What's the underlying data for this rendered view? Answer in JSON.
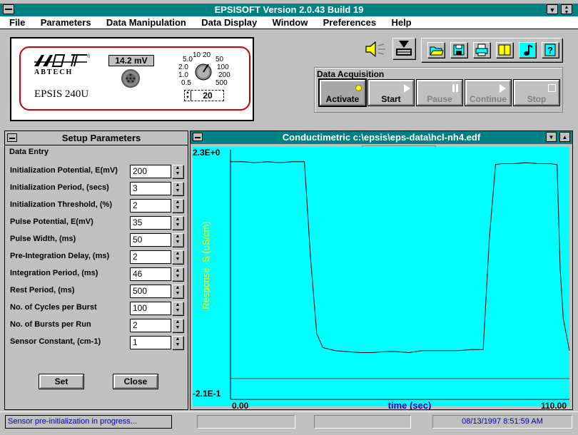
{
  "app": {
    "title": "EPSISOFT Version 2.0.43  Build 19"
  },
  "menu": [
    "File",
    "Parameters",
    "Data Manipulation",
    "Data Display",
    "Window",
    "Preferences",
    "Help"
  ],
  "instrument": {
    "brand": "ABTECH",
    "model": "EPSIS 240U",
    "mv_readout": "14.2 mV",
    "dial_ticks": [
      "5.0",
      "10",
      "20",
      "50",
      "2.0",
      "100",
      "1.0",
      "200",
      "0.5",
      "500"
    ],
    "range_value": "20"
  },
  "toolbar_icons": [
    "open-folder-icon",
    "save-disk-icon",
    "print-icon",
    "book-icon",
    "music-note-icon",
    "help-question-icon"
  ],
  "data_acquisition": {
    "title": "Data Acquisition",
    "buttons": [
      {
        "label": "Activate",
        "enabled": true
      },
      {
        "label": "Start",
        "enabled": true
      },
      {
        "label": "Pause",
        "enabled": false
      },
      {
        "label": "Continue",
        "enabled": false
      },
      {
        "label": "Stop",
        "enabled": false
      }
    ]
  },
  "setup": {
    "title": "Setup Parameters",
    "section": "Data Entry",
    "fields": [
      {
        "label": "Initialization Potential, E(mV)",
        "value": "200"
      },
      {
        "label": "Initialization Period, (secs)",
        "value": "3"
      },
      {
        "label": "Initialization Threshold, (%)",
        "value": "2"
      },
      {
        "label": "Pulse Potential, E(mV)",
        "value": "35"
      },
      {
        "label": "Pulse Width, (ms)",
        "value": "50"
      },
      {
        "label": "Pre-Integration Delay, (ms)",
        "value": "2"
      },
      {
        "label": "Integration Period, (ms)",
        "value": "46"
      },
      {
        "label": "Rest Period, (ms)",
        "value": "500"
      },
      {
        "label": "No. of Cycles per Burst",
        "value": "100"
      },
      {
        "label": "No. of Bursts per Run",
        "value": "2"
      },
      {
        "label": "Sensor Constant, (cm-1)",
        "value": "1"
      }
    ],
    "set_label": "Set",
    "close_label": "Close"
  },
  "plot": {
    "title": "Conductimetric c:\\epsis\\eps-data\\hcl-nh4.edf",
    "colors": {
      "background": "#00ffff",
      "trace": "#000000",
      "label": "#ffff00"
    }
  },
  "chart_data": {
    "type": "line",
    "xlabel": "time (sec)",
    "ylabel": "Response, S (uS/cm)",
    "xlim": [
      0,
      110
    ],
    "ylim": [
      -0.21,
      2.3
    ],
    "y_top_label": "2.3E+0",
    "y_bottom_label": "-2.1E-1",
    "x_left_label": "0.00",
    "x_right_label": "110.00",
    "baseline_y": 0,
    "series": [
      {
        "x": [
          0,
          4,
          8,
          12,
          16,
          20,
          24,
          26,
          28,
          30,
          34,
          38,
          42,
          46,
          50,
          54,
          58,
          62,
          66,
          70,
          74,
          78,
          82,
          84,
          86,
          88,
          92,
          96,
          100,
          104,
          106,
          107,
          108,
          110
        ],
        "y": [
          2.18,
          2.18,
          2.17,
          2.18,
          2.17,
          2.18,
          2.18,
          1.2,
          0.45,
          0.31,
          0.28,
          0.27,
          0.26,
          0.26,
          0.27,
          0.27,
          0.26,
          0.28,
          0.28,
          0.28,
          0.28,
          0.29,
          0.29,
          1.4,
          2.15,
          2.16,
          2.16,
          2.17,
          2.16,
          2.16,
          2.15,
          1.1,
          0.6,
          0.28
        ]
      }
    ]
  },
  "status": {
    "message": "Sensor pre-initialization in progress...",
    "timestamp": "08/13/1997 8:51:59 AM"
  }
}
